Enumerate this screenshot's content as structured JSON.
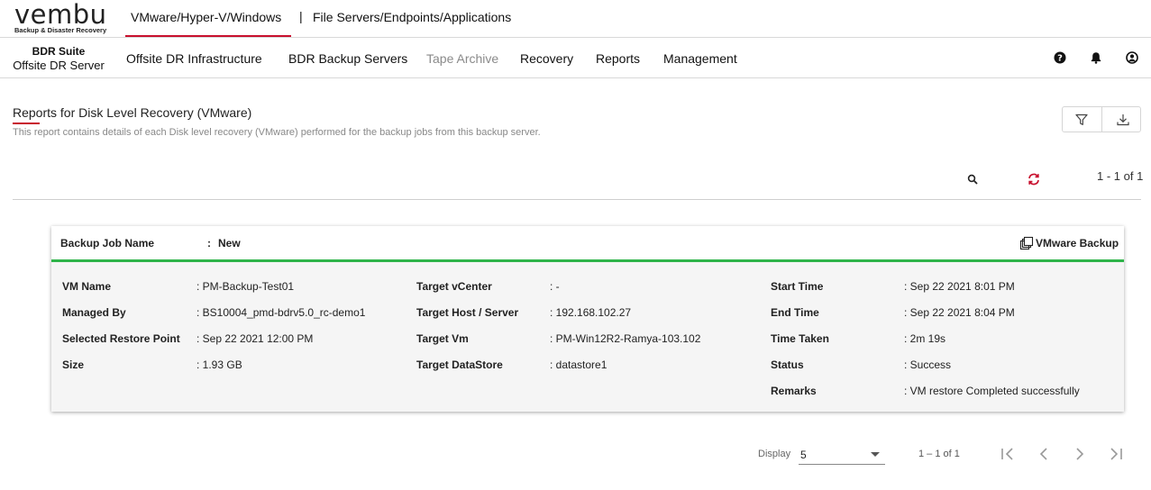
{
  "brand": {
    "name": "vembu",
    "tagline": "Backup & Disaster Recovery"
  },
  "top_tabs": [
    {
      "label": "VMware/Hyper-V/Windows",
      "active": true
    },
    {
      "label": "File Servers/Endpoints/Applications",
      "active": false
    }
  ],
  "top_separator": "|",
  "suite": {
    "line1": "BDR Suite",
    "line2": "Offsite DR Server"
  },
  "nav": [
    {
      "label": "Offsite DR Infrastructure",
      "disabled": false
    },
    {
      "label": "BDR Backup Servers",
      "disabled": false
    },
    {
      "label": "Tape Archive",
      "disabled": true
    },
    {
      "label": "Recovery",
      "disabled": false
    },
    {
      "label": "Reports",
      "disabled": false
    },
    {
      "label": "Management",
      "disabled": false
    }
  ],
  "header_icons": [
    "help-icon",
    "bell-icon",
    "user-icon"
  ],
  "report": {
    "title": "Reports for Disk Level Recovery (VMware)",
    "description": "This report contains details of each Disk level recovery (VMware) performed for the backup jobs from this backup server.",
    "range_text": "1 - 1 of 1"
  },
  "card": {
    "backup_job_label": "Backup Job Name",
    "colon": ":",
    "backup_job_value": "New",
    "type_badge": "VMware Backup",
    "accent_color": "#2fb44a",
    "col1": [
      {
        "label": "VM Name",
        "value": ": PM-Backup-Test01"
      },
      {
        "label": "Managed By",
        "value": ": BS10004_pmd-bdrv5.0_rc-demo1"
      },
      {
        "label": "Selected Restore Point",
        "value": ": Sep 22 2021 12:00 PM"
      },
      {
        "label": "Size",
        "value": ": 1.93 GB"
      }
    ],
    "col2": [
      {
        "label": "Target vCenter",
        "value": ": -"
      },
      {
        "label": "Target Host / Server",
        "value": ": 192.168.102.27"
      },
      {
        "label": "Target Vm",
        "value": ": PM-Win12R2-Ramya-103.102"
      },
      {
        "label": "Target DataStore",
        "value": ": datastore1"
      }
    ],
    "col3": [
      {
        "label": "Start Time",
        "value": ": Sep 22 2021 8:01 PM"
      },
      {
        "label": "End Time",
        "value": ": Sep 22 2021 8:04 PM"
      },
      {
        "label": "Time Taken",
        "value": ": 2m 19s"
      },
      {
        "label": "Status",
        "value": ": Success"
      },
      {
        "label": "Remarks",
        "value": ": VM restore Completed successfully"
      }
    ]
  },
  "pagination": {
    "display_label": "Display",
    "display_value": "5",
    "range_text": "1 – 1 of 1"
  },
  "colors": {
    "accent_red": "#c8102e",
    "success_green": "#2fb44a"
  }
}
